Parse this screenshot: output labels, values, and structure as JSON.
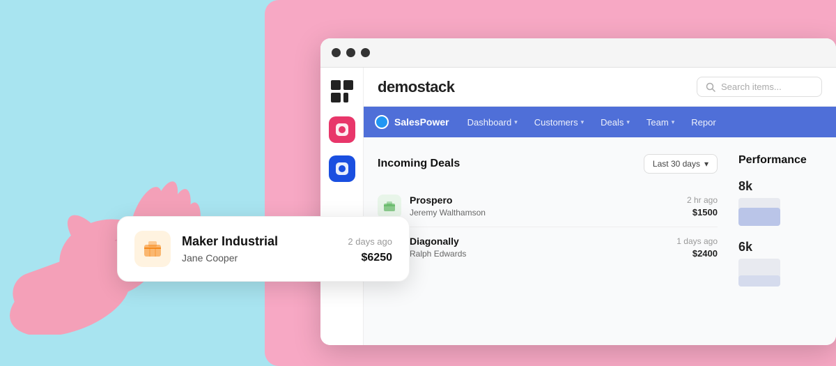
{
  "background": {
    "color": "#b8eaf5",
    "pink_shape_color": "#f7a8c4"
  },
  "browser": {
    "dots": [
      "#333",
      "#333",
      "#333"
    ],
    "sidebar": {
      "logo_label": "grid-logo",
      "icons": [
        {
          "color": "#e8366a",
          "label": "pink-app-icon"
        },
        {
          "color": "#1a4fe0",
          "label": "blue-app-icon"
        }
      ]
    },
    "header": {
      "app_name": "demostack",
      "search_placeholder": "Search items..."
    },
    "nav": {
      "brand": "SalesPower",
      "items": [
        {
          "label": "Dashboard",
          "has_dropdown": true
        },
        {
          "label": "Customers",
          "has_dropdown": true
        },
        {
          "label": "Deals",
          "has_dropdown": true
        },
        {
          "label": "Team",
          "has_dropdown": true
        },
        {
          "label": "Repor",
          "has_dropdown": false
        }
      ]
    },
    "content": {
      "incoming_deals": {
        "title": "Incoming Deals",
        "filter": "Last 30 days",
        "filter_chevron": "▾",
        "deals": [
          {
            "name": "Prospero",
            "person": "Jeremy Walthamson",
            "time": "2 hr ago",
            "amount": "$1500",
            "icon_color": "#e8f5e9",
            "icon": "📦"
          },
          {
            "name": "Diagonally",
            "person": "Ralph Edwards",
            "time": "1 days ago",
            "amount": "$2400",
            "icon_color": "#e8f5e9",
            "icon": "📦"
          }
        ]
      },
      "performance": {
        "title": "Performance",
        "values": [
          "8k",
          "6k"
        ]
      }
    }
  },
  "floating_card": {
    "company": "Maker Industrial",
    "time": "2 days ago",
    "person": "Jane Cooper",
    "amount": "$6250",
    "icon": "📦",
    "icon_bg": "#fff3e0"
  }
}
